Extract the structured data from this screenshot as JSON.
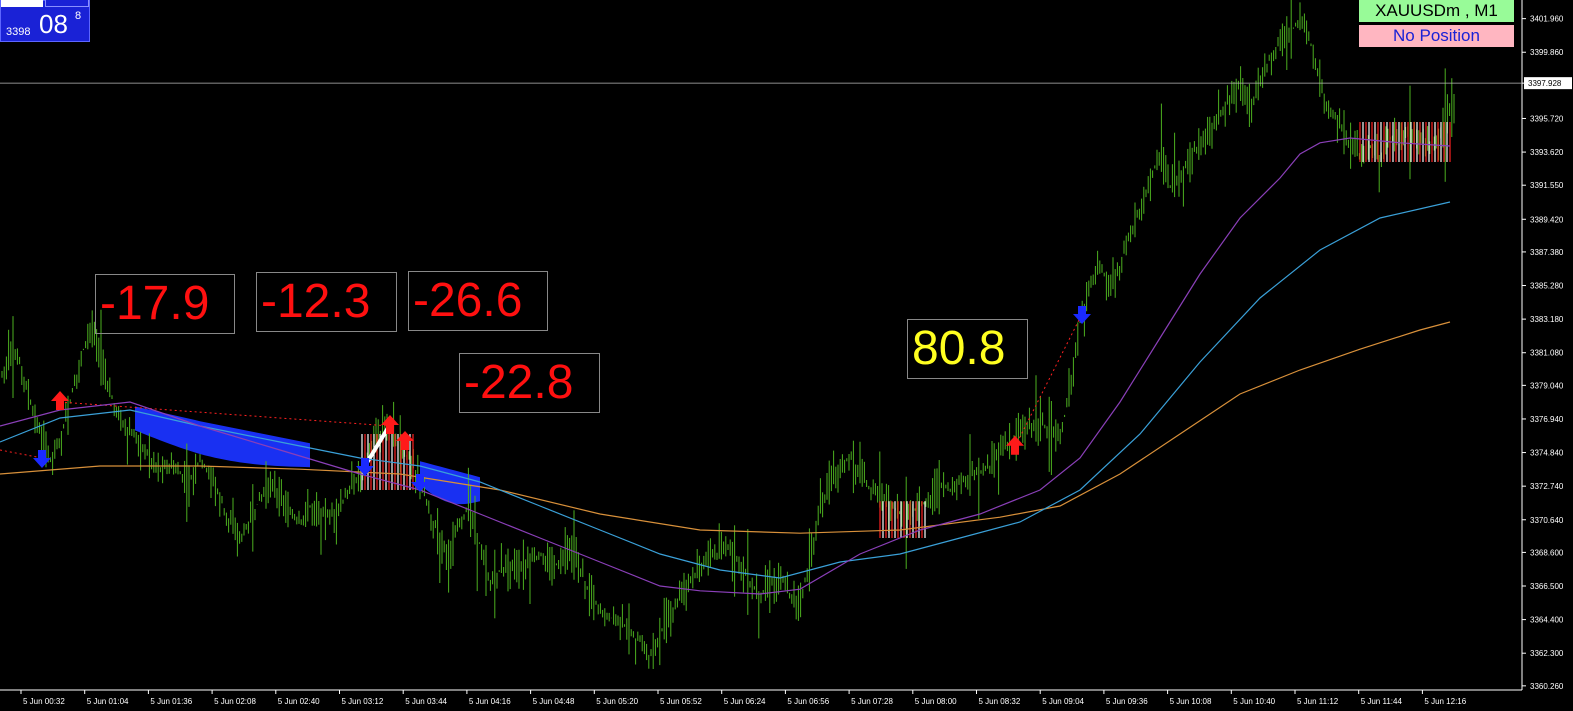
{
  "price_box": {
    "small": "3398",
    "big": "08",
    "sup": "8"
  },
  "symbol_label": "XAUUSDm , M1",
  "position_label": "No Position",
  "current_price_label": "3397.928",
  "colors": {
    "candles": "#4caf1f",
    "fast_ma": "#c8f050",
    "ma_purple": "#8a3fb8",
    "ma_blue": "#3aa0d8",
    "ma_orange": "#d8903a",
    "fill_blue": "#1a33ff",
    "label_red": "#ff1010",
    "label_yellow": "#ffff20"
  },
  "profit_labels": [
    {
      "id": "a",
      "text": "-17.9",
      "color": "red"
    },
    {
      "id": "b",
      "text": "-12.3",
      "color": "red"
    },
    {
      "id": "c",
      "text": "-26.6",
      "color": "red"
    },
    {
      "id": "d",
      "text": "-22.8",
      "color": "red"
    },
    {
      "id": "e",
      "text": "80.8",
      "color": "yellow"
    }
  ],
  "chart_data": {
    "type": "line",
    "symbol": "XAUUSDm",
    "timeframe": "M1",
    "ylim": [
      3360.0,
      3403.0
    ],
    "y_ticks": [
      "3401.960",
      "3399.860",
      "3397.928",
      "3395.720",
      "3393.620",
      "3391.550",
      "3389.420",
      "3387.380",
      "3385.280",
      "3383.180",
      "3381.080",
      "3379.040",
      "3376.940",
      "3374.840",
      "3372.740",
      "3370.640",
      "3368.600",
      "3366.500",
      "3364.400",
      "3362.300",
      "3360.260"
    ],
    "x_ticks": [
      "5 Jun 00:32",
      "5 Jun 01:04",
      "5 Jun 01:36",
      "5 Jun 02:08",
      "5 Jun 02:40",
      "5 Jun 03:12",
      "5 Jun 03:44",
      "5 Jun 04:16",
      "5 Jun 04:48",
      "5 Jun 05:20",
      "5 Jun 05:52",
      "5 Jun 06:24",
      "5 Jun 06:56",
      "5 Jun 07:28",
      "5 Jun 08:00",
      "5 Jun 08:32",
      "5 Jun 09:04",
      "5 Jun 09:36",
      "5 Jun 10:08",
      "5 Jun 10:40",
      "5 Jun 11:12",
      "5 Jun 11:44",
      "5 Jun 12:16"
    ],
    "current_price": 3397.928,
    "price_series": {
      "x": [
        0,
        10,
        20,
        30,
        40,
        50,
        60,
        70,
        80,
        90,
        100,
        110,
        120,
        130,
        140,
        150,
        160,
        170,
        180,
        190,
        200,
        210,
        220,
        230,
        240,
        250,
        260,
        270,
        280,
        290,
        300,
        310,
        320,
        330,
        340,
        350,
        360,
        370,
        380,
        390,
        400,
        410,
        420,
        430,
        440,
        450,
        460,
        470,
        480,
        490,
        500,
        510,
        520,
        530,
        540,
        550,
        560,
        570,
        580,
        590,
        600,
        610,
        620,
        630,
        640,
        650,
        660,
        670,
        680,
        690,
        700,
        710,
        720,
        730,
        740,
        750,
        760,
        770,
        780,
        790,
        800,
        810,
        820,
        830,
        840,
        850,
        860,
        870,
        880,
        890,
        900,
        910,
        920,
        930,
        940,
        950,
        960,
        970,
        980,
        990,
        1000,
        1010,
        1020,
        1030,
        1040,
        1050,
        1060,
        1070,
        1080,
        1090,
        1100,
        1110,
        1120,
        1130,
        1140,
        1150,
        1160,
        1170,
        1180,
        1190,
        1200,
        1210,
        1220,
        1230,
        1240,
        1250,
        1260,
        1270,
        1280,
        1290,
        1300,
        1310,
        1320,
        1330,
        1340,
        1350,
        1360,
        1370,
        1380,
        1390,
        1400,
        1410,
        1420,
        1430,
        1440,
        1450
      ],
      "y": [
        3379.5,
        3381.0,
        3380.5,
        3378.0,
        3376.0,
        3374.5,
        3375.5,
        3378.0,
        3380.5,
        3382.8,
        3381.0,
        3378.5,
        3377.0,
        3376.0,
        3375.5,
        3374.5,
        3373.8,
        3374.0,
        3373.5,
        3373.0,
        3374.5,
        3373.5,
        3372.0,
        3370.5,
        3369.5,
        3370.5,
        3372.0,
        3373.0,
        3372.0,
        3371.0,
        3370.5,
        3371.5,
        3371.0,
        3370.8,
        3371.5,
        3372.5,
        3373.5,
        3375.0,
        3376.0,
        3377.0,
        3375.0,
        3374.5,
        3373.0,
        3371.0,
        3369.5,
        3368.5,
        3370.5,
        3371.5,
        3369.0,
        3366.5,
        3367.5,
        3368.0,
        3367.5,
        3368.0,
        3368.5,
        3367.5,
        3368.0,
        3369.0,
        3367.5,
        3366.0,
        3365.0,
        3364.5,
        3364.5,
        3363.5,
        3363.0,
        3362.0,
        3363.5,
        3364.5,
        3366.0,
        3367.0,
        3367.5,
        3368.5,
        3368.5,
        3369.0,
        3368.0,
        3366.5,
        3366.0,
        3366.5,
        3367.0,
        3366.0,
        3365.5,
        3368.0,
        3371.0,
        3373.5,
        3374.0,
        3374.5,
        3373.5,
        3372.5,
        3372.5,
        3371.5,
        3371.0,
        3371.0,
        3371.5,
        3372.0,
        3373.0,
        3372.5,
        3373.0,
        3373.5,
        3373.5,
        3374.0,
        3375.0,
        3375.5,
        3376.0,
        3376.5,
        3377.0,
        3376.0,
        3375.5,
        3379.0,
        3383.0,
        3385.5,
        3386.5,
        3385.0,
        3386.5,
        3388.5,
        3390.0,
        3392.0,
        3393.5,
        3391.5,
        3392.0,
        3393.5,
        3394.0,
        3395.0,
        3396.0,
        3397.0,
        3398.0,
        3396.5,
        3398.0,
        3399.5,
        3400.5,
        3401.0,
        3402.0,
        3400.5,
        3398.0,
        3396.0,
        3395.5,
        3394.0,
        3393.5,
        3394.0,
        3393.0,
        3394.5,
        3394.5,
        3395.0,
        3394.5,
        3394.0,
        3394.5,
        3396.5
      ]
    },
    "ma_fast": {
      "x": [
        0,
        40,
        80,
        100,
        130,
        160,
        200,
        240,
        280,
        320,
        360,
        390,
        420,
        460,
        500,
        540,
        580,
        620,
        660,
        700,
        740,
        780,
        800,
        840,
        880,
        920,
        960,
        1000,
        1040,
        1080,
        1120,
        1160,
        1200,
        1240,
        1280,
        1300,
        1320,
        1350,
        1380,
        1420,
        1450
      ],
      "y": [
        3378.0,
        3376.0,
        3379.5,
        3381.0,
        3378.5,
        3375.0,
        3374.0,
        3371.5,
        3371.0,
        3370.8,
        3373.0,
        3375.5,
        3373.5,
        3370.5,
        3368.5,
        3367.5,
        3367.0,
        3365.5,
        3363.5,
        3366.0,
        3367.5,
        3366.5,
        3367.0,
        3371.5,
        3372.5,
        3371.5,
        3372.5,
        3374.0,
        3375.5,
        3376.5,
        3383.0,
        3386.5,
        3390.0,
        3393.0,
        3396.0,
        3398.5,
        3400.5,
        3397.0,
        3394.5,
        3394.5,
        3395.0
      ]
    },
    "ma_purple": {
      "x": [
        0,
        60,
        130,
        200,
        280,
        360,
        420,
        480,
        540,
        600,
        660,
        700,
        760,
        800,
        860,
        920,
        980,
        1040,
        1080,
        1120,
        1160,
        1200,
        1240,
        1280,
        1300,
        1320,
        1350,
        1400,
        1450
      ],
      "y": [
        3376.5,
        3377.5,
        3378.0,
        3376.5,
        3375.0,
        3373.5,
        3372.5,
        3371.0,
        3369.5,
        3368.0,
        3366.5,
        3366.2,
        3366.0,
        3366.3,
        3368.5,
        3370.0,
        3371.0,
        3372.5,
        3374.5,
        3378.0,
        3382.0,
        3386.0,
        3389.5,
        3392.0,
        3393.5,
        3394.2,
        3394.5,
        3394.2,
        3394.0
      ]
    },
    "ma_blue": {
      "x": [
        0,
        60,
        130,
        200,
        280,
        360,
        420,
        480,
        540,
        600,
        660,
        720,
        780,
        840,
        900,
        960,
        1020,
        1080,
        1140,
        1200,
        1260,
        1320,
        1380,
        1450
      ],
      "y": [
        3375.5,
        3377.0,
        3377.5,
        3376.5,
        3375.5,
        3374.5,
        3374.0,
        3373.0,
        3371.5,
        3370.0,
        3368.5,
        3367.5,
        3367.0,
        3368.0,
        3368.5,
        3369.5,
        3370.5,
        3372.5,
        3376.0,
        3380.5,
        3384.5,
        3387.5,
        3389.5,
        3390.5
      ]
    },
    "ma_orange": {
      "x": [
        0,
        100,
        200,
        300,
        400,
        500,
        600,
        700,
        800,
        900,
        1000,
        1060,
        1120,
        1180,
        1240,
        1300,
        1360,
        1420,
        1450
      ],
      "y": [
        3373.5,
        3374.0,
        3374.0,
        3373.8,
        3373.5,
        3372.5,
        3371.0,
        3370.0,
        3369.8,
        3370.0,
        3370.8,
        3371.5,
        3373.5,
        3376.0,
        3378.5,
        3380.0,
        3381.3,
        3382.5,
        3383.0
      ]
    },
    "buy_arrows": [
      {
        "x": 60,
        "y": 3378.0
      },
      {
        "x": 390,
        "y": 3376.5
      },
      {
        "x": 405,
        "y": 3375.5
      },
      {
        "x": 1015,
        "y": 3375.2
      }
    ],
    "sell_arrows": [
      {
        "x": 42,
        "y": 3374.5
      },
      {
        "x": 365,
        "y": 3374.0
      },
      {
        "x": 420,
        "y": 3373.0
      },
      {
        "x": 1082,
        "y": 3383.5
      }
    ]
  }
}
